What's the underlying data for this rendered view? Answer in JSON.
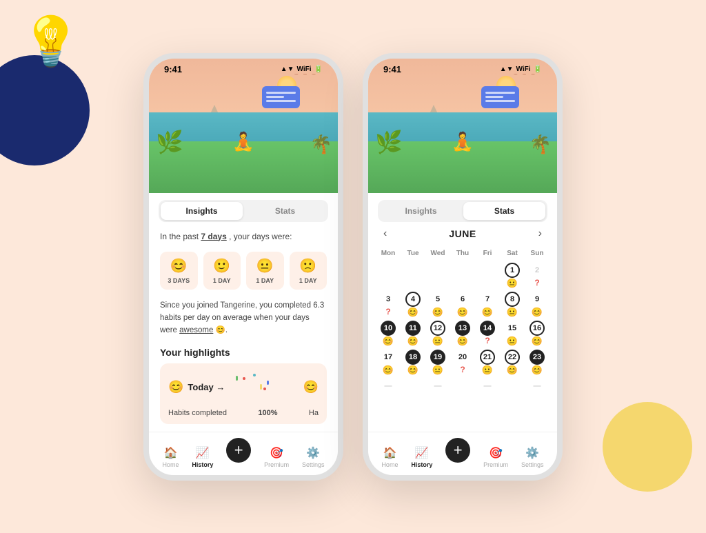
{
  "background": {
    "color": "#fde8da"
  },
  "decorative": {
    "lightbulb": "💡",
    "bg_circle_blue": "#1a2a6e",
    "bg_circle_yellow": "#f5d76e"
  },
  "phone1": {
    "status_bar": {
      "time": "9:41",
      "icons": "▲ ▼ 📶 🔋"
    },
    "tabs": [
      {
        "label": "Insights",
        "active": true
      },
      {
        "label": "Stats",
        "active": false
      }
    ],
    "insights": {
      "summary": "In the past",
      "days_underline": "7 days",
      "summary2": ", your days were:",
      "moods": [
        {
          "emoji": "😊",
          "label": "3 DAYS"
        },
        {
          "emoji": "🙂",
          "label": "1 DAY"
        },
        {
          "emoji": "😐",
          "label": "1 DAY"
        },
        {
          "emoji": "🙁",
          "label": "1 DAY"
        }
      ],
      "habit_text1": "Since you joined Tangerine, you completed 6.3",
      "habit_text2": "habits per day on average when your days",
      "habit_text3": "were",
      "habit_awesome": "awesome",
      "habit_emoji": "😊",
      "highlights_title": "Your highlights",
      "today_emoji": "😊",
      "today_label": "Today →",
      "habits_label": "Habits completed",
      "habits_pct": "100%",
      "ha_label": "Ha"
    },
    "nav": {
      "items": [
        {
          "label": "Home",
          "icon": "🏠",
          "active": false
        },
        {
          "label": "History",
          "icon": "📈",
          "active": true
        },
        {
          "label": "",
          "icon": "+",
          "active": false,
          "is_add": true
        },
        {
          "label": "Premium",
          "icon": "🎯",
          "active": false
        },
        {
          "label": "Settings",
          "icon": "⚙️",
          "active": false
        }
      ]
    }
  },
  "phone2": {
    "status_bar": {
      "time": "9:41",
      "icons": "▲ ▼ 📶 🔋"
    },
    "tabs": [
      {
        "label": "Insights",
        "active": false
      },
      {
        "label": "Stats",
        "active": true
      }
    ],
    "calendar": {
      "month": "JUNE",
      "days_headers": [
        "Mon",
        "Tue",
        "Wed",
        "Thu",
        "Fri",
        "Sat",
        "Sun"
      ],
      "weeks": [
        [
          {
            "num": "",
            "emoji": "",
            "style": "empty"
          },
          {
            "num": "",
            "emoji": "",
            "style": "empty"
          },
          {
            "num": "",
            "emoji": "",
            "style": "empty"
          },
          {
            "num": "",
            "emoji": "",
            "style": "empty"
          },
          {
            "num": "",
            "emoji": "",
            "style": "empty"
          },
          {
            "num": "1",
            "emoji": "😐",
            "style": "circle"
          },
          {
            "num": "2",
            "emoji": "?",
            "style": "muted",
            "emoji_red": true
          }
        ],
        [
          {
            "num": "3",
            "emoji": "?",
            "style": "normal",
            "emoji_red": true
          },
          {
            "num": "4",
            "emoji": "😊",
            "style": "circle"
          },
          {
            "num": "5",
            "emoji": "😊",
            "style": "normal"
          },
          {
            "num": "6",
            "emoji": "😊",
            "style": "normal"
          },
          {
            "num": "7",
            "emoji": "😊",
            "style": "normal"
          },
          {
            "num": "8",
            "emoji": "😐",
            "style": "circle"
          },
          {
            "num": "9",
            "emoji": "😊",
            "style": "normal"
          }
        ],
        [
          {
            "num": "10",
            "emoji": "😊",
            "style": "filled"
          },
          {
            "num": "11",
            "emoji": "😊",
            "style": "filled"
          },
          {
            "num": "12",
            "emoji": "😐",
            "style": "circle"
          },
          {
            "num": "13",
            "emoji": "😊",
            "style": "filled"
          },
          {
            "num": "14",
            "emoji": "?",
            "style": "filled",
            "emoji_red": true
          },
          {
            "num": "15",
            "emoji": "😐",
            "style": "normal"
          },
          {
            "num": "16",
            "emoji": "😊",
            "style": "circle"
          }
        ],
        [
          {
            "num": "17",
            "emoji": "😊",
            "style": "normal"
          },
          {
            "num": "18",
            "emoji": "😊",
            "style": "filled"
          },
          {
            "num": "19",
            "emoji": "😐",
            "style": "filled"
          },
          {
            "num": "20",
            "emoji": "?",
            "style": "normal",
            "emoji_red": true
          },
          {
            "num": "21",
            "emoji": "😐",
            "style": "circle"
          },
          {
            "num": "22",
            "emoji": "😊",
            "style": "circle"
          },
          {
            "num": "23",
            "emoji": "😊",
            "style": "filled"
          }
        ],
        [
          {
            "num": "—",
            "emoji": "",
            "style": "muted"
          },
          {
            "num": "",
            "emoji": "",
            "style": "empty"
          },
          {
            "num": "—",
            "emoji": "",
            "style": "muted"
          },
          {
            "num": "",
            "emoji": "",
            "style": "empty"
          },
          {
            "num": "—",
            "emoji": "",
            "style": "muted"
          },
          {
            "num": "",
            "emoji": "",
            "style": "empty"
          },
          {
            "num": "—",
            "emoji": "",
            "style": "muted"
          }
        ]
      ]
    },
    "nav": {
      "items": [
        {
          "label": "Home",
          "icon": "🏠",
          "active": false
        },
        {
          "label": "History",
          "icon": "📈",
          "active": true
        },
        {
          "label": "",
          "icon": "+",
          "active": false,
          "is_add": true
        },
        {
          "label": "Premium",
          "icon": "🎯",
          "active": false
        },
        {
          "label": "Settings",
          "icon": "⚙️",
          "active": false
        }
      ]
    }
  }
}
